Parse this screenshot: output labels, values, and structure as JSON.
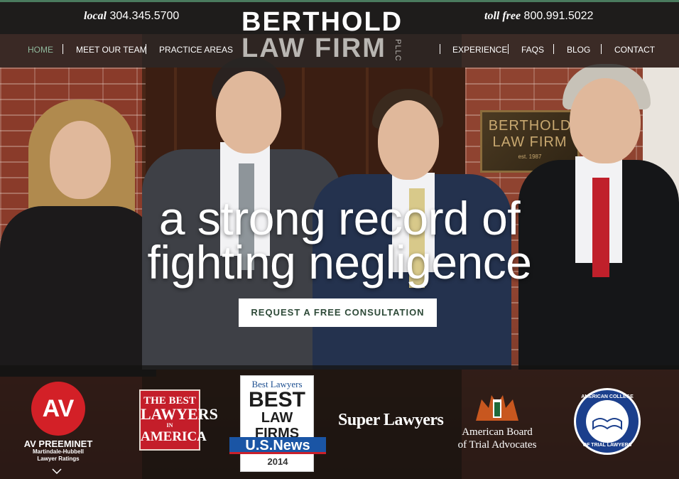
{
  "header": {
    "local_label": "local",
    "local_number": "304.345.5700",
    "tollfree_label": "toll free",
    "tollfree_number": "800.991.5022",
    "logo_line1": "BERTHOLD",
    "logo_line2": "LAW FIRM",
    "logo_suffix": "PLLC"
  },
  "nav": {
    "items": [
      "HOME",
      "MEET OUR TEAM",
      "PRACTICE AREAS",
      "EXPERIENCE",
      "FAQS",
      "BLOG",
      "CONTACT"
    ],
    "active": "HOME"
  },
  "plaque": {
    "line1": "BERTHOLD",
    "line2": "LAW FIRM",
    "est": "est. 1987"
  },
  "hero": {
    "headline_line1": "a strong record of",
    "headline_line2": "fighting negligence",
    "cta_label": "REQUEST A FREE CONSULTATION"
  },
  "awards": {
    "av_badge": "AV",
    "av_title": "AV PREEMINET",
    "av_sub1": "Martindale-Hubbell",
    "av_sub2": "Lawyer Ratings",
    "bla_line1": "THE BEST",
    "bla_line2": "LAWYERS",
    "bla_line3": "IN",
    "bla_line4": "AMERICA",
    "blf_brand": "Best Lawyers",
    "blf_line1": "BEST",
    "blf_line2": "LAW FIRMS",
    "blf_usnews": "U.S.News",
    "blf_year": "2014",
    "super_lawyers": "Super Lawyers",
    "abta_line1": "American Board",
    "abta_line2": "of Trial Advocates",
    "acl_top": "AMERICAN COLLEGE",
    "acl_bottom": "OF TRIAL LAWYERS"
  },
  "colors": {
    "accent_green": "#8fb89c",
    "cta_text": "#2e4a38",
    "av_red": "#d32027",
    "usnews_blue": "#1a55a5"
  }
}
